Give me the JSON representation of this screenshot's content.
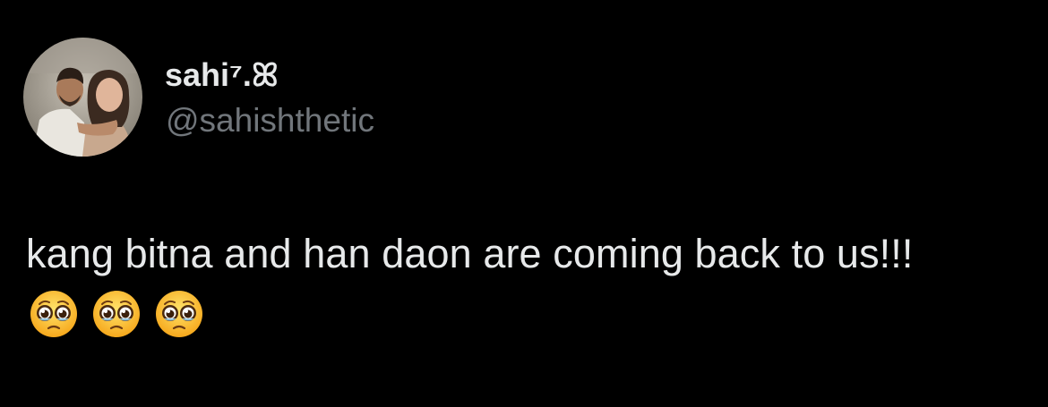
{
  "tweet": {
    "display_name": "sahi⁷.ꕤ",
    "handle": "@sahishthetic",
    "text": "kang bitna and han daon are coming back to us!!!",
    "emojis": [
      "pleading-face-emoji",
      "pleading-face-emoji",
      "pleading-face-emoji"
    ]
  },
  "colors": {
    "background": "#000000",
    "primary_text": "#e7e9ea",
    "secondary_text": "#71767b"
  }
}
